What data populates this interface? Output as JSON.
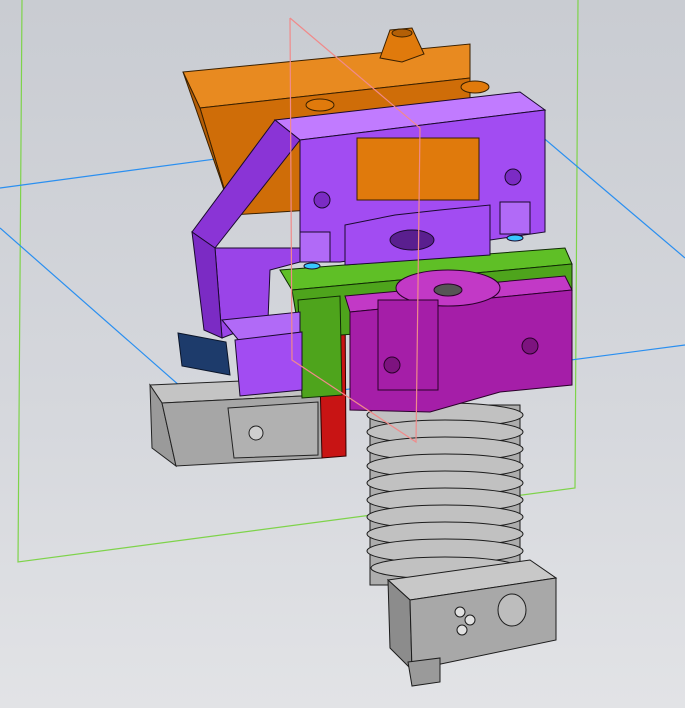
{
  "viewport": {
    "name": "cad-3d-viewport",
    "background": "#d3d6db",
    "colors": {
      "purple_body": "#a24cf2",
      "orange_carriage": "#e07a0c",
      "magenta_clamp": "#a51ea8",
      "green_plate": "#4ea41c",
      "red_plate": "#c81414",
      "gray_part": "#a8a8a8",
      "heatsink": "#b5b5b5",
      "navy_tab": "#1d3b6b",
      "blue_plane": "#2a8ff0",
      "green_plane": "#7ed34a",
      "red_plane": "#f08a8a"
    },
    "icons": [
      "origin-plane-xy",
      "origin-plane-yz",
      "origin-plane-xz"
    ]
  }
}
